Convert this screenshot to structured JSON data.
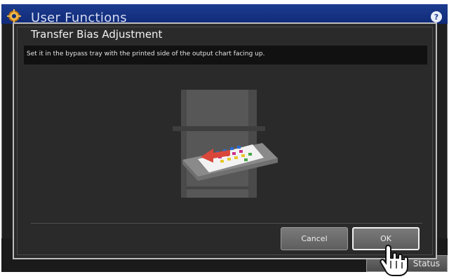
{
  "app": {
    "title": "User Functions",
    "help_icon_label": "?",
    "status_label": "Status"
  },
  "dialog": {
    "title": "Transfer Bias Adjustment",
    "message": "Set it in the bypass tray with the printed side of the output chart facing up.",
    "buttons": {
      "cancel": "Cancel",
      "ok": "OK"
    }
  },
  "icons": {
    "gear": "gear-icon",
    "help": "help-icon",
    "pointer": "hand-pointer-icon"
  },
  "colors": {
    "header_blue": "#102c7a",
    "dialog_bg": "#2a2a2a",
    "arrow_red": "#d9473a"
  }
}
